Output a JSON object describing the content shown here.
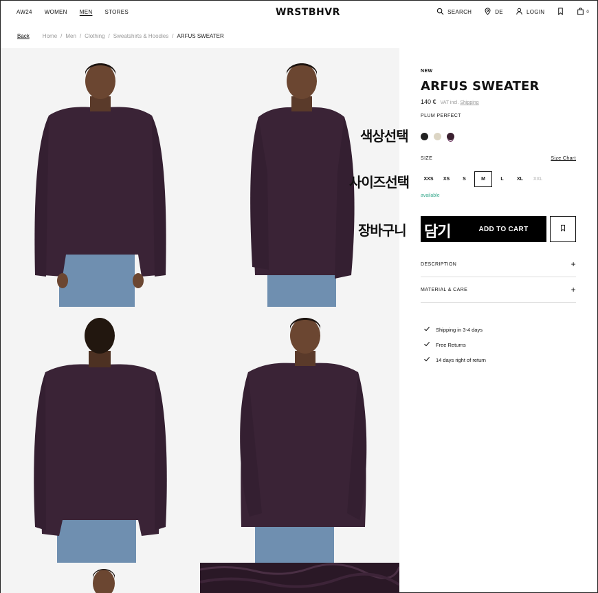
{
  "header": {
    "nav_left": [
      "AW24",
      "WOMEN",
      "MEN",
      "STORES"
    ],
    "active_nav": "MEN",
    "logo": "WRSTBHVR",
    "search_label": "SEARCH",
    "country_label": "DE",
    "login_label": "LOGIN",
    "cart_count": "0"
  },
  "breadcrumb": {
    "back": "Back",
    "items": [
      "Home",
      "Men",
      "Clothing",
      "Sweatshirts & Hoodies"
    ],
    "current": "ARFUS SWEATER"
  },
  "product": {
    "badge": "NEW",
    "title": "ARFUS SWEATER",
    "price": "140 €",
    "vat_text": "VAT incl.",
    "shipping_link": "Shipping",
    "color_name": "PLUM PERFECT",
    "swatches": [
      {
        "name": "black",
        "color": "#222222"
      },
      {
        "name": "cream",
        "color": "#dcd5c4"
      },
      {
        "name": "plum",
        "color": "#3b2030"
      }
    ],
    "size_label": "SIZE",
    "size_chart": "Size Chart",
    "sizes": [
      "XXS",
      "XS",
      "S",
      "M",
      "L",
      "XL",
      "XXL"
    ],
    "selected_size": "M",
    "unavailable_size": "XXL",
    "availability": "available",
    "add_to_cart": "ADD TO CART",
    "accordions": [
      "DESCRIPTION",
      "MATERIAL & CARE"
    ],
    "benefits": [
      "Shipping in 3-4 days",
      "Free Returns",
      "14 days right of return"
    ]
  },
  "annotations": {
    "color_select": "색상선택",
    "size_select": "사이즈선택",
    "cart_prefix": "장바구니",
    "cart_suffix": "담기"
  },
  "colors": {
    "sweater": "#3a2336",
    "jeans": "#6f8fb0",
    "available": "#36a88c"
  }
}
